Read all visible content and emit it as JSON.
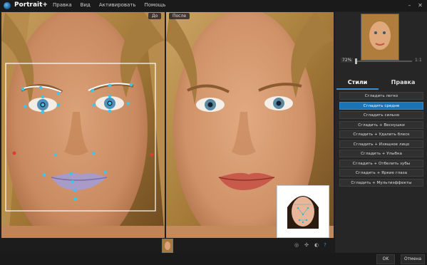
{
  "app": {
    "title": "Portrait+"
  },
  "menu": [
    "Правка",
    "Вид",
    "Активировать",
    "Помощь"
  ],
  "window": {
    "minimize_icon": "minimize-icon",
    "close_icon": "close-icon"
  },
  "view": {
    "before_label": "До",
    "after_label": "После"
  },
  "navigator": {
    "zoom": "72%",
    "fit": "1:1"
  },
  "tabs": {
    "styles": "Стили",
    "edit": "Правка"
  },
  "presets": [
    "Сгладить легко",
    "Сгладить средне",
    "Сгладить сильно",
    "Сгладить + Веснушки",
    "Сгладить + Удалить блеск",
    "Сгладить + Изящное лицо",
    "Сгладить + Улыбка",
    "Сгладить + Отбелить зубы",
    "Сгладить + Яркие глаза",
    "Сгладить + Мультиэффекты"
  ],
  "selected_preset": "Сгладить средне",
  "toolbar_icons": [
    "face-detect-icon",
    "mask-icon",
    "hand-icon",
    "help-icon"
  ],
  "footer": {
    "ok": "OK",
    "cancel": "Отмена"
  },
  "colors": {
    "accent": "#1a73b5",
    "landmark": "#3ec6e8",
    "landmark_edge": "#e03a3a"
  }
}
